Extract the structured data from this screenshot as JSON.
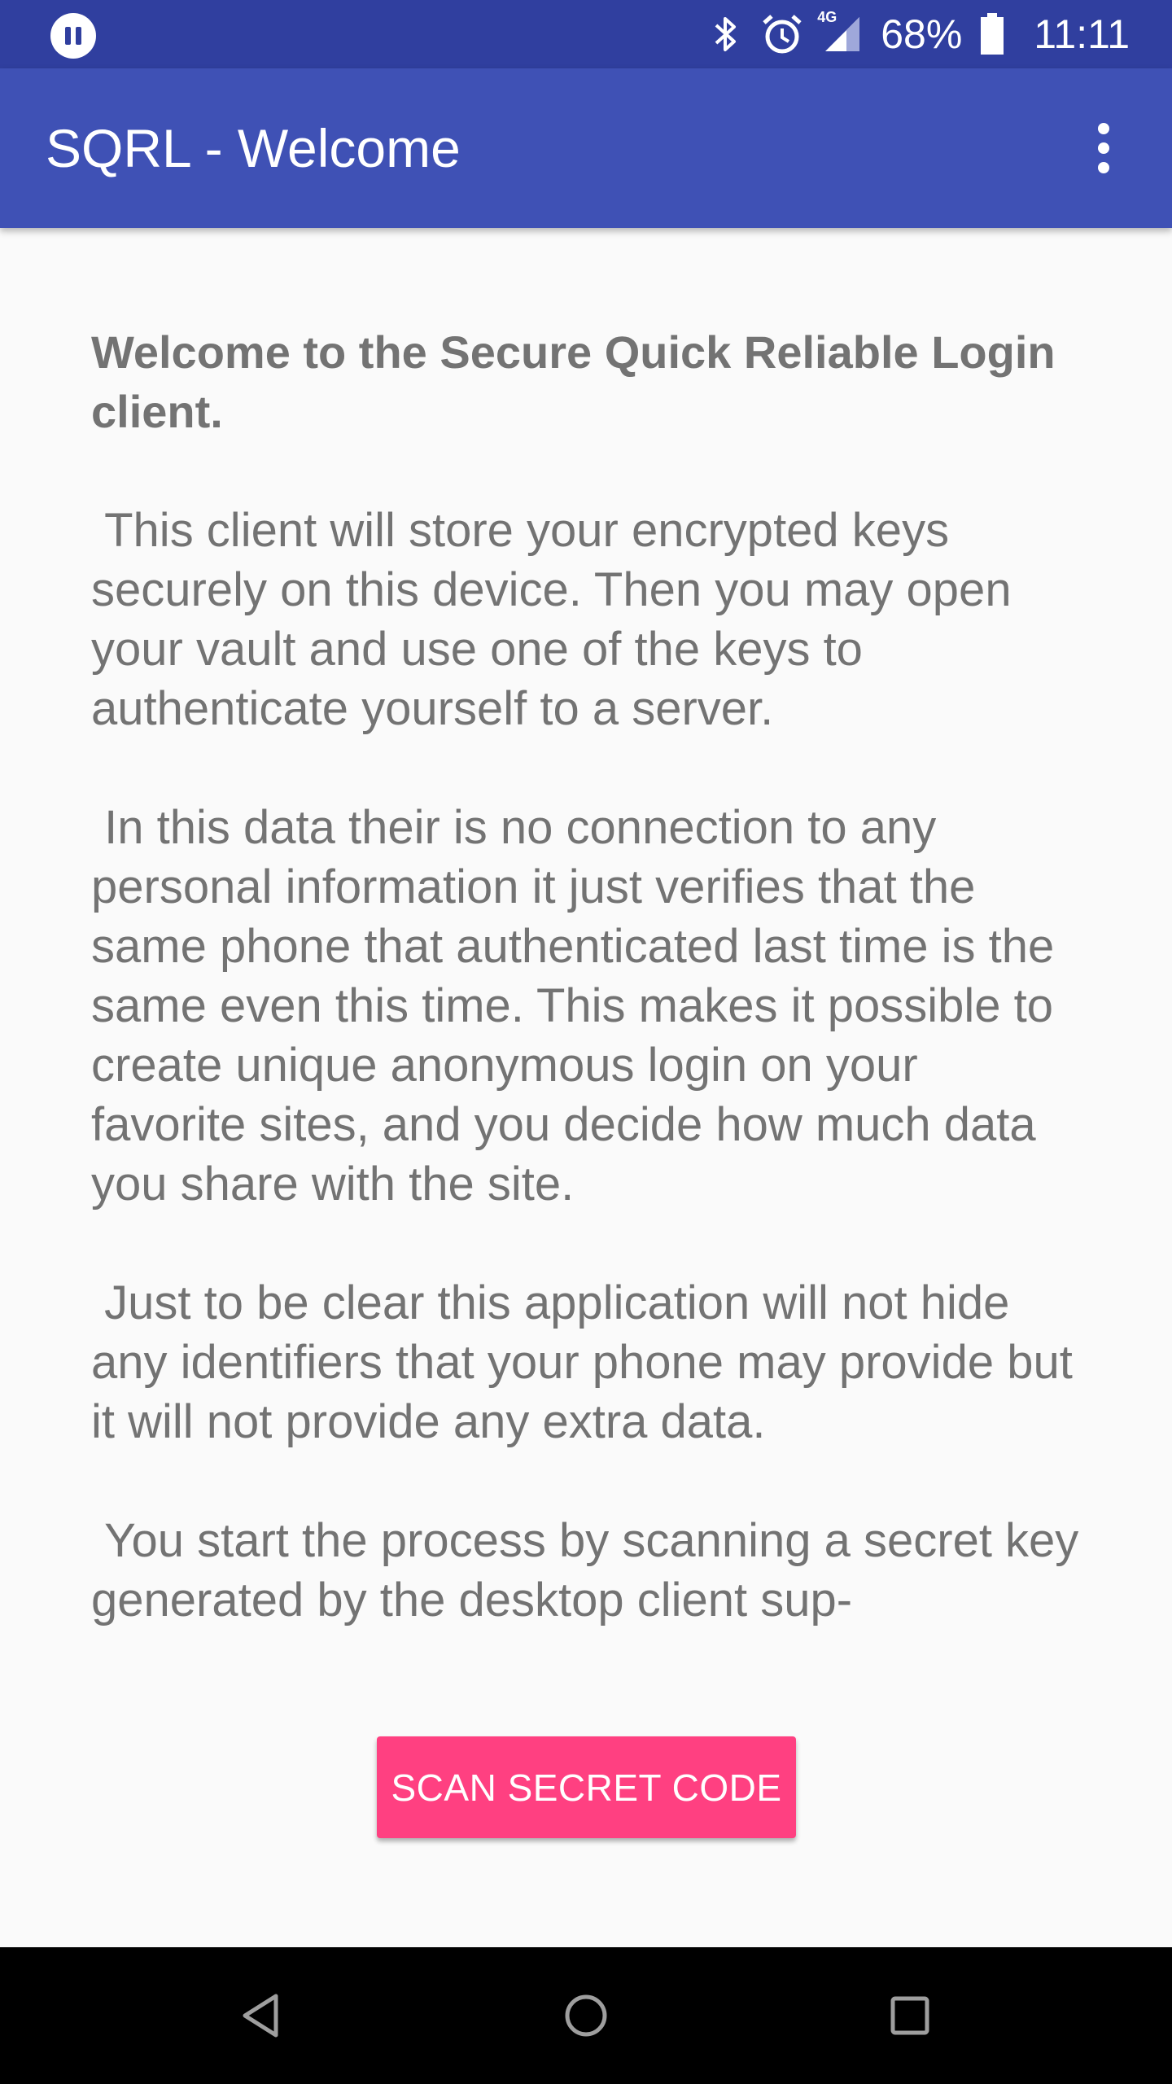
{
  "status_bar": {
    "icons": [
      "media-paused-icon",
      "bluetooth-icon",
      "alarm-icon",
      "signal-4g-icon",
      "battery-icon"
    ],
    "network_label": "4G",
    "battery": "68%",
    "time": "11:11"
  },
  "app_bar": {
    "title": "SQRL - Welcome",
    "menu_icon": "more-vertical-icon"
  },
  "content": {
    "heading": "Welcome to the Secure Quick Reliable Login client.",
    "paragraphs": [
      " This client will store your encrypted keys securely on this device. Then you may open your vault and use one of the keys to authenticate yourself to a server.",
      " In this data their is no connection to any personal information it just verifies that the same phone that authenticated last time is the same even this time. This makes it possible to create unique anonymous login on your favorite sites, and you decide how much data you share with the site.",
      " Just to be clear this application will not hide any identifiers that your phone may provide but it will not provide any extra data.",
      " You start the process by scanning a secret key generated by the desktop client sup-"
    ]
  },
  "actions": {
    "scan_label": "SCAN SECRET CODE"
  },
  "nav_bar": {
    "icons": [
      "back-icon",
      "home-icon",
      "recents-icon"
    ]
  },
  "colors": {
    "status_bar": "#303f9f",
    "app_bar": "#3f51b5",
    "accent": "#ff4081",
    "background": "#fafafa",
    "body_text": "#737373",
    "nav_bar": "#000000"
  }
}
